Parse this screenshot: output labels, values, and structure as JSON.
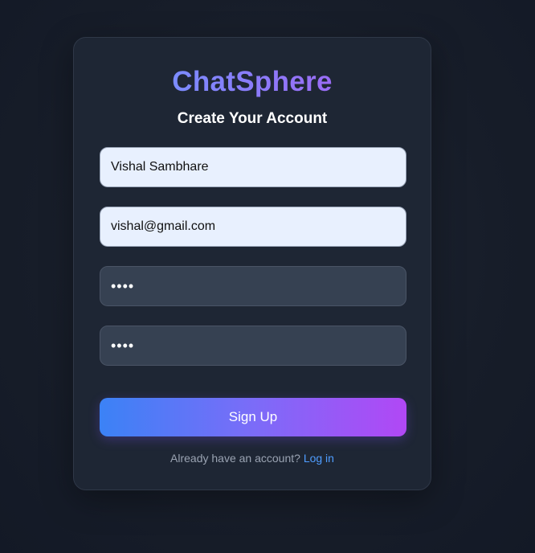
{
  "app": {
    "brand": "ChatSphere",
    "subtitle": "Create Your Account"
  },
  "form": {
    "name_value": "Vishal Sambhare",
    "email_value": "vishal@gmail.com",
    "password_value": "abcd",
    "confirm_password_value": "abcd",
    "submit_label": "Sign Up"
  },
  "footer": {
    "prompt": "Already have an account?",
    "login_label": "Log in"
  },
  "colors": {
    "accent_blue": "#3b82f6",
    "accent_purple": "#b148f5",
    "link": "#4f9dff",
    "card_bg": "#1e2634"
  }
}
